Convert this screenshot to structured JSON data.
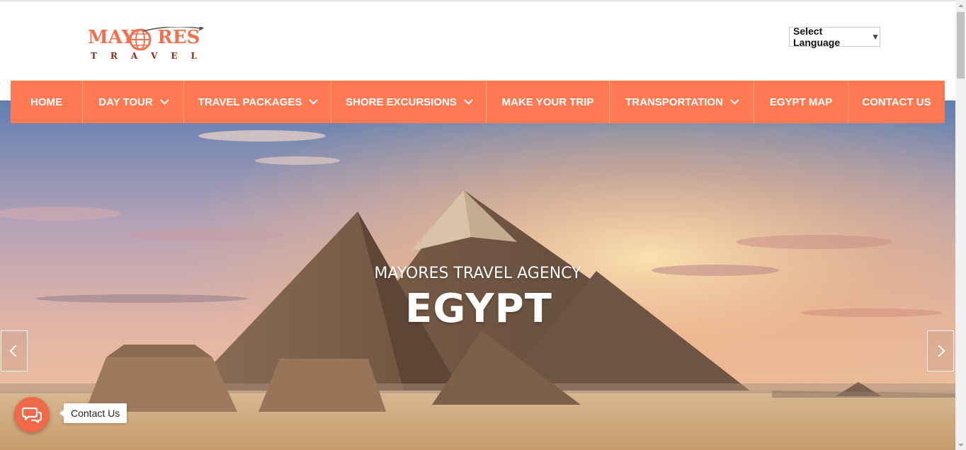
{
  "logo": {
    "name": "MAYORES",
    "name_part1": "MAY",
    "name_part2": "RES",
    "sub_letters": [
      "T",
      "R",
      "A",
      "V",
      "E",
      "L"
    ]
  },
  "language_select": {
    "label": "Select Language"
  },
  "nav": {
    "items": [
      {
        "label": "HOME",
        "has_dropdown": false
      },
      {
        "label": "DAY TOUR",
        "has_dropdown": true
      },
      {
        "label": "TRAVEL PACKAGES",
        "has_dropdown": true
      },
      {
        "label": "SHORE EXCURSIONS",
        "has_dropdown": true
      },
      {
        "label": "MAKE YOUR TRIP",
        "has_dropdown": false
      },
      {
        "label": "TRANSPORTATION",
        "has_dropdown": true
      },
      {
        "label": "EGYPT MAP",
        "has_dropdown": false
      },
      {
        "label": "CONTACT US",
        "has_dropdown": false
      }
    ]
  },
  "hero": {
    "subtitle": "MAYORES TRAVEL AGENCY",
    "title": "EGYPT"
  },
  "chat": {
    "label": "Contact Us"
  },
  "colors": {
    "accent": "#ff7a52",
    "logo": "#f0714d",
    "logo_dark": "#8a2b1e"
  }
}
